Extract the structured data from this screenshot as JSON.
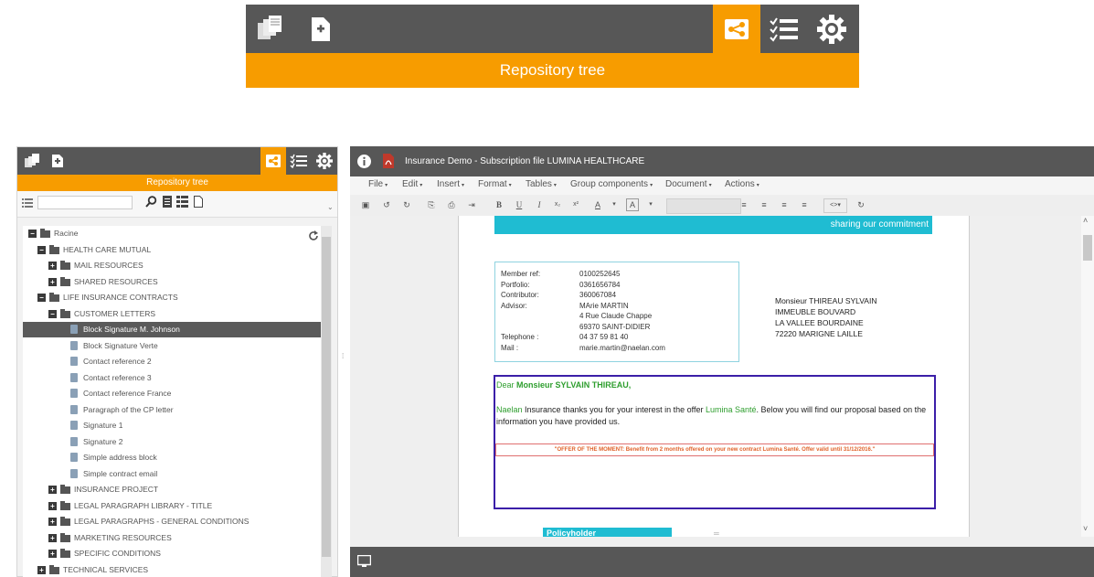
{
  "zoomed_toolbar": {
    "title": "Repository tree",
    "icons": [
      "documents-icon",
      "add-document-icon",
      "repository-tree-icon",
      "checklist-icon",
      "gear-icon"
    ]
  },
  "left_panel": {
    "title": "Repository tree",
    "search": {
      "value": "",
      "placeholder": ""
    },
    "tree": [
      {
        "label": "Racine",
        "level": 0,
        "type": "folder",
        "expanded": true
      },
      {
        "label": "HEALTH CARE MUTUAL",
        "level": 1,
        "type": "folder",
        "expanded": true
      },
      {
        "label": "MAIL RESOURCES",
        "level": 2,
        "type": "folder",
        "expanded": false
      },
      {
        "label": "SHARED RESOURCES",
        "level": 2,
        "type": "folder",
        "expanded": false
      },
      {
        "label": "LIFE INSURANCE CONTRACTS",
        "level": 1,
        "type": "folder",
        "expanded": true
      },
      {
        "label": "CUSTOMER LETTERS",
        "level": 2,
        "type": "folder",
        "expanded": true
      },
      {
        "label": "Block Signature M. Johnson",
        "level": 3,
        "type": "doc",
        "selected": true
      },
      {
        "label": "Block Signature Verte",
        "level": 3,
        "type": "doc"
      },
      {
        "label": "Contact reference 2",
        "level": 3,
        "type": "doc"
      },
      {
        "label": "Contact reference 3",
        "level": 3,
        "type": "doc"
      },
      {
        "label": "Contact reference France",
        "level": 3,
        "type": "doc"
      },
      {
        "label": "Paragraph of the CP letter",
        "level": 3,
        "type": "doc"
      },
      {
        "label": "Signature 1",
        "level": 3,
        "type": "doc"
      },
      {
        "label": "Signature 2",
        "level": 3,
        "type": "doc"
      },
      {
        "label": "Simple address block",
        "level": 3,
        "type": "doc"
      },
      {
        "label": "Simple contract email",
        "level": 3,
        "type": "doc"
      },
      {
        "label": "INSURANCE PROJECT",
        "level": 2,
        "type": "folder",
        "expanded": false
      },
      {
        "label": "LEGAL PARAGRAPH LIBRARY - TITLE",
        "level": 2,
        "type": "folder",
        "expanded": false
      },
      {
        "label": "LEGAL PARAGRAPHS - GENERAL CONDITIONS",
        "level": 2,
        "type": "folder",
        "expanded": false
      },
      {
        "label": "MARKETING RESOURCES",
        "level": 2,
        "type": "folder",
        "expanded": false
      },
      {
        "label": "SPECIFIC CONDITIONS",
        "level": 2,
        "type": "folder",
        "expanded": false
      },
      {
        "label": "TECHNICAL SERVICES",
        "level": 1,
        "type": "folder",
        "expanded": false
      }
    ]
  },
  "editor": {
    "title": "Insurance Demo - Subscription file LUMINA HEALTHCARE",
    "menu": [
      "File",
      "Edit",
      "Insert",
      "Format",
      "Tables",
      "Group components",
      "Document",
      "Actions"
    ],
    "banner_text": "sharing our commitment",
    "member_block": [
      {
        "label": "Member ref:",
        "value": "0100252645"
      },
      {
        "label": "Portfolio:",
        "value": "0361656784"
      },
      {
        "label": "Contributor:",
        "value": "360067084"
      },
      {
        "label": "Advisor:",
        "value": "MArie MARTIN"
      },
      {
        "label": "",
        "value": "4 Rue Claude Chappe"
      },
      {
        "label": "",
        "value": "69370 SAINT-DIDIER"
      },
      {
        "label": "Telephone :",
        "value": "04 37 59 81 40"
      },
      {
        "label": "Mail :",
        "value": "marie.martin@naelan.com"
      }
    ],
    "address": [
      "Monsieur THIREAU SYLVAIN",
      "IMMEUBLE BOUVARD",
      "LA VALLEE BOURDAINE",
      "72220 MARIGNE LAILLE"
    ],
    "greeting_prefix": "Dear",
    "greeting_name": "Monsieur SYLVAIN THIREAU,",
    "body_company": "Naelan",
    "body_text_1": " Insurance thanks you for your interest in the offer ",
    "offer_name": "Lumina Santé",
    "body_text_2": ". Below you will find our proposal based on the information you have provided us.",
    "offer_banner": "\"OFFER OF THE MOMENT: Benefit from 2 months offered on your new contract Lumina Santé. Offer valid until 31/12/2016.\"",
    "section_heading": "Policyholder"
  },
  "colors": {
    "accent": "#f79c00",
    "dark": "#575757",
    "teal": "#1fbcd2",
    "purple": "#3b1fa8",
    "green": "#2e9e2e",
    "offer": "#e0622a"
  }
}
